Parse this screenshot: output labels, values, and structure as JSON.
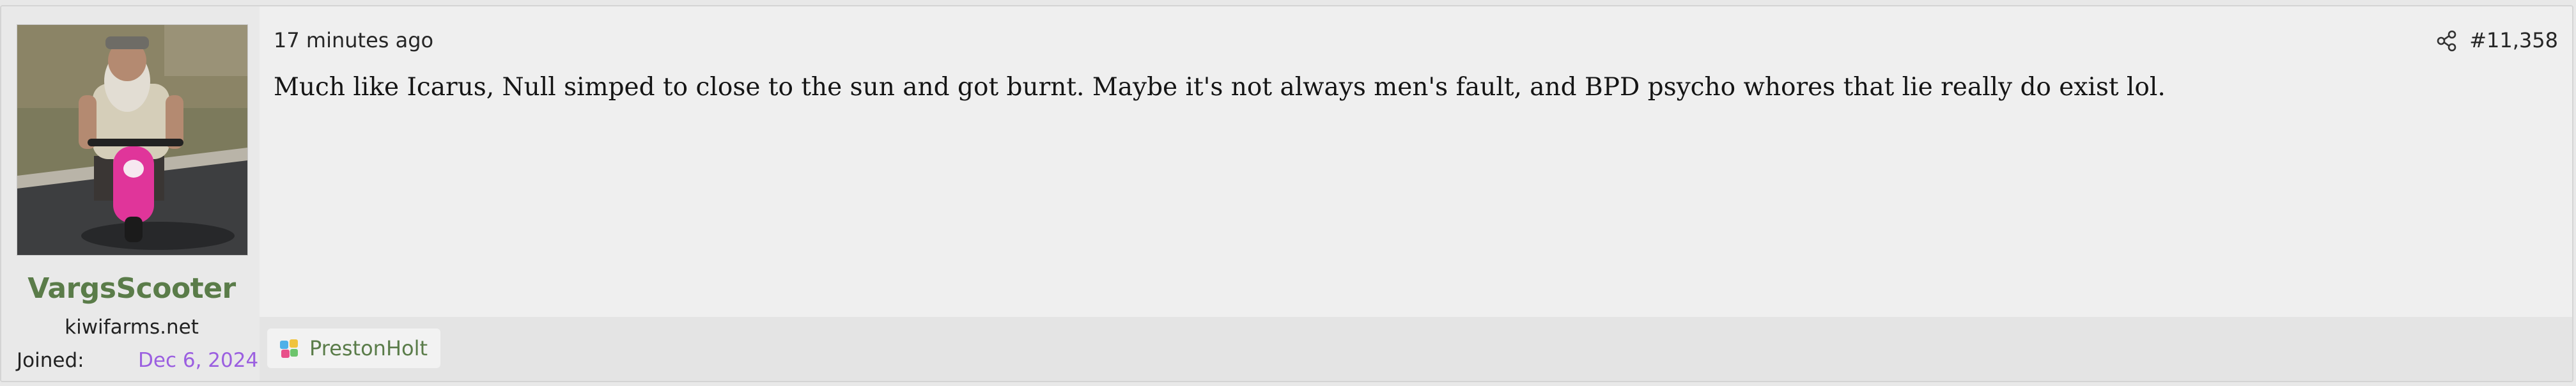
{
  "post": {
    "timestamp": "17 minutes ago",
    "number": "#11,358",
    "message": "Much like Icarus, Null simped to close to the sun and got burnt. Maybe it's not always men's fault, and BPD psycho whores that lie really do exist lol."
  },
  "user": {
    "name": "VargsScooter",
    "title": "kiwifarms.net",
    "joined_label": "Joined:",
    "joined_value": "Dec 6, 2024",
    "avatar_icon": "man-on-pink-scooter-photo"
  },
  "reactions": [
    {
      "icon": "multicolor-sticker-icon",
      "user": "PrestonHolt"
    }
  ],
  "icons": {
    "share": "share-icon"
  },
  "colors": {
    "username": "#5a7c49",
    "joined_date": "#9b5fe0",
    "reaction_user": "#5a7c49"
  }
}
